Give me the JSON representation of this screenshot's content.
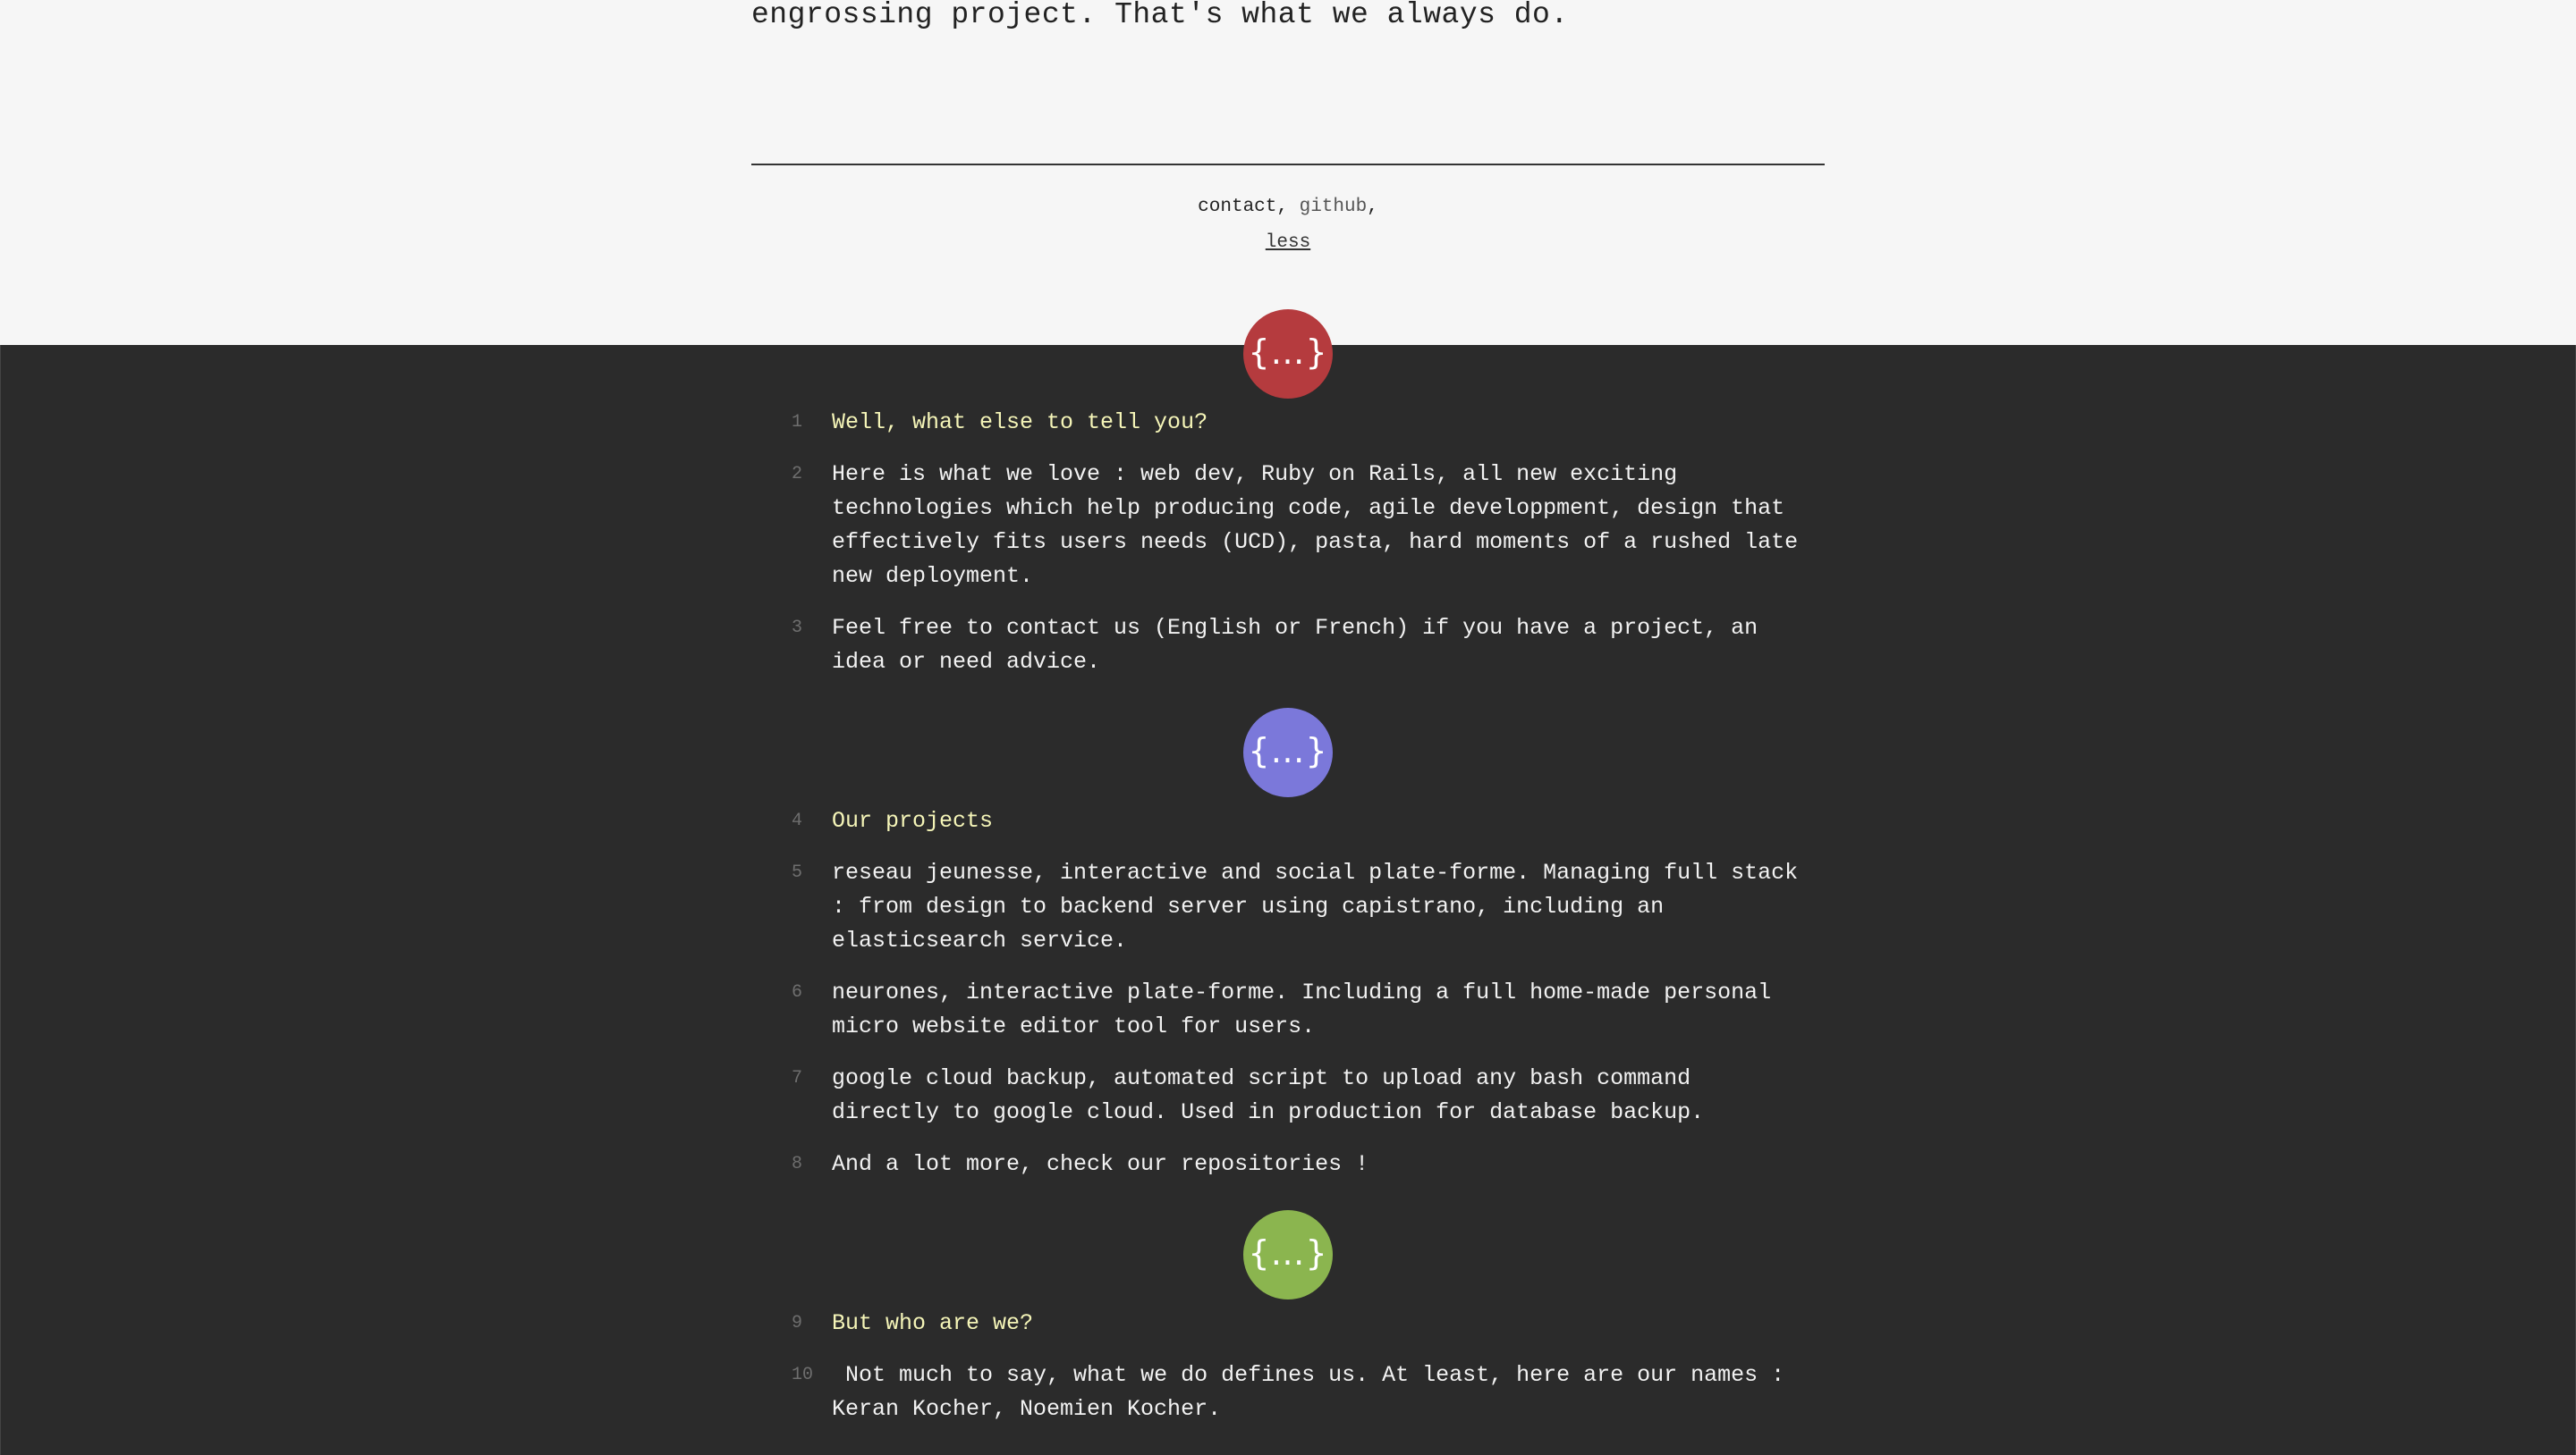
{
  "intro": {
    "tail": "engrossing project. That's what we always do."
  },
  "footer": {
    "contact": "contact",
    "sep1": ",",
    "github": "github",
    "sep2": ",",
    "less": "less"
  },
  "badges": [
    {
      "glyph": "{…}",
      "color": "#b53b3e"
    },
    {
      "glyph": "{…}",
      "color": "#7b78da"
    },
    {
      "glyph": "{…}",
      "color": "#8bb54f"
    }
  ],
  "lines": [
    {
      "n": "1",
      "text": "Well, what else to tell you?"
    },
    {
      "n": "2",
      "text": "Here is what we love : web dev, Ruby on Rails, all new exciting technologies which help producing code, agile developpment, design that effectively fits users needs (UCD), pasta, hard moments of a rushed late new deployment."
    },
    {
      "n": "3",
      "text": "Feel free to contact us (English or French) if you have a project, an idea or need advice."
    },
    {
      "n": "4",
      "text": "Our projects"
    },
    {
      "n": "5",
      "text": "reseau jeunesse, interactive and social plate-forme. Managing full stack : from design to backend server using capistrano, including an elasticsearch service."
    },
    {
      "n": "6",
      "text": "neurones, interactive plate-forme. Including a full home-made personal micro website editor tool for users."
    },
    {
      "n": "7",
      "text": "google cloud backup, automated script to upload any bash command directly to google cloud. Used in production for database backup."
    },
    {
      "n": "8",
      "text": "And a lot more, check our repositories !"
    },
    {
      "n": "9",
      "text": "But who are we?"
    },
    {
      "n": "10",
      "text": " Not much to say, what we do defines us. At least, here are our names : Keran Kocher, Noemien Kocher."
    }
  ]
}
